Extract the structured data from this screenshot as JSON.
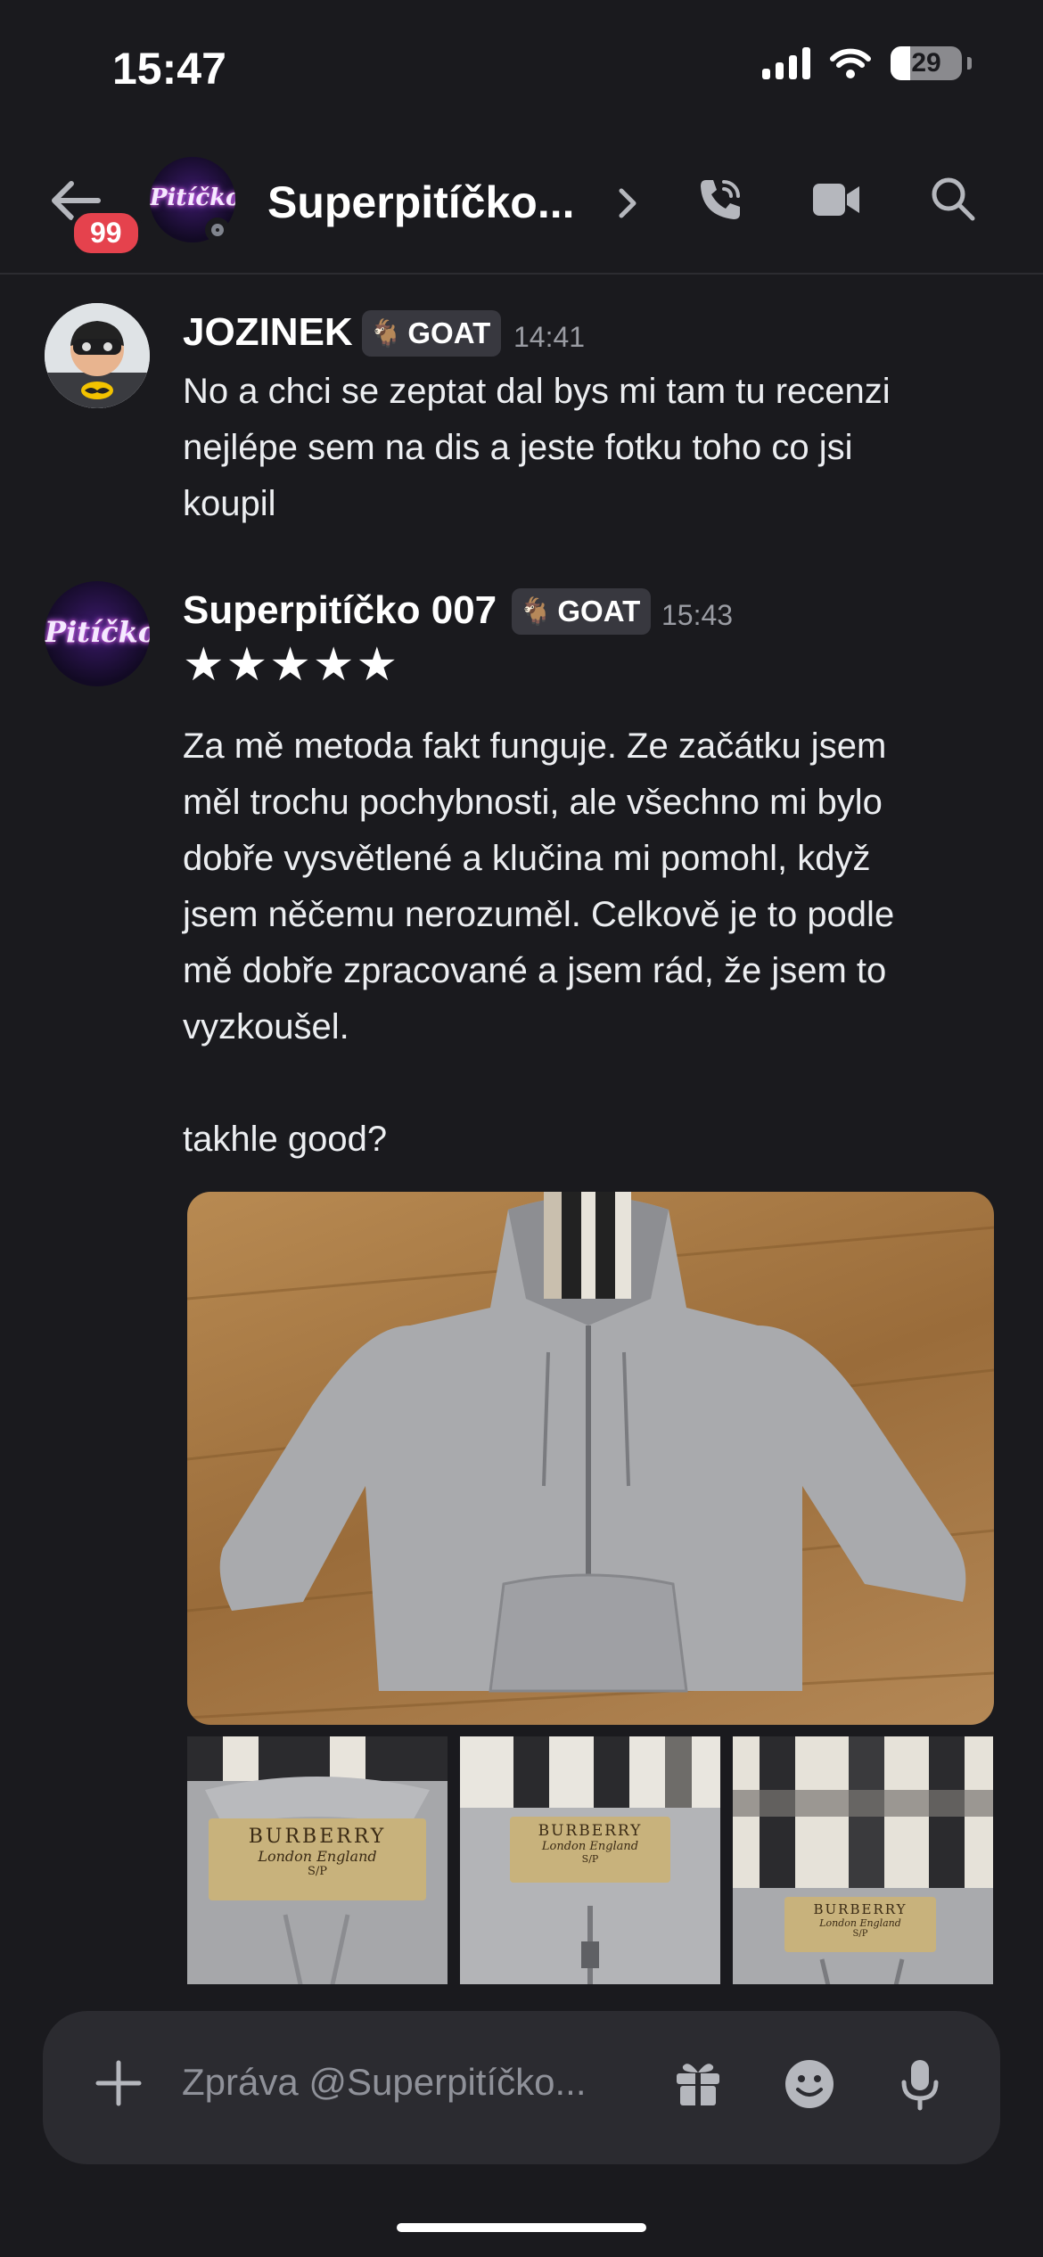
{
  "status_bar": {
    "time": "15:47",
    "battery": "29"
  },
  "header": {
    "unread_badge": "99",
    "avatar_text": "Pitíčko",
    "channel_name": "Superpitíčko...",
    "icons": [
      "back-arrow-icon",
      "chevron-right-icon",
      "phone-call-icon",
      "video-camera-icon",
      "search-icon"
    ]
  },
  "messages": [
    {
      "author": "JOZINEK",
      "role_tag": "GOAT",
      "time": "14:41",
      "text": "No a chci se zeptat dal bys mi tam tu recenzi\nnejlépe sem na dis a jeste fotku toho co jsi\nkoupil"
    },
    {
      "author": "Superpitíčko 007",
      "role_tag": "GOAT",
      "time": "15:43",
      "avatar_text": "Pitíčko",
      "rating": "★★★★★",
      "text": "Za mě metoda fakt funguje. Ze začátku jsem\nměl trochu pochybnosti, ale všechno mi bylo\ndobře vysvětlené a klučina mi pomohl, když\njsem něčemu nerozuměl. Celkově je to podle\nmě dobře zpracované a jsem rád, že jsem to\nvyzkoušel.\n\ntakhle good?",
      "attachments": {
        "main_photo": "grey-zip-hoodie-photo",
        "label_lines": [
          "BURBERRY",
          "London England",
          "S/P"
        ]
      }
    }
  ],
  "composer": {
    "placeholder": "Zpráva @Superpitíčko...",
    "icons": [
      "plus-icon",
      "gift-icon",
      "emoji-icon",
      "microphone-icon"
    ]
  },
  "colors": {
    "background": "#1a1a1e",
    "badge": "#e5424d",
    "composer": "#2b2b30"
  }
}
